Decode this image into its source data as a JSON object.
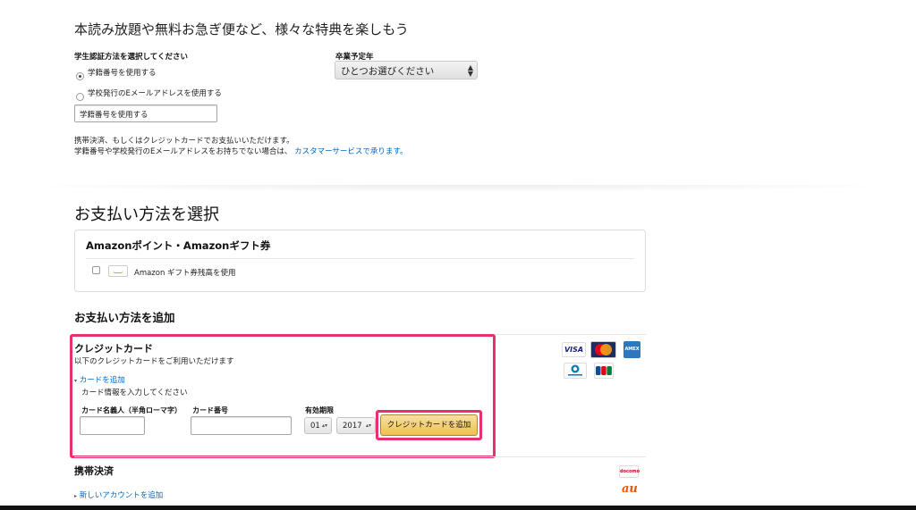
{
  "promo": {
    "heading": "本読み放題や無料お急ぎ便など、様々な特典を楽しもう",
    "verify_label": "学生認証方法を選択してください",
    "option_student_id": "学籍番号を使用する",
    "option_email": "学校発行のEメールアドレスを使用する",
    "input_value": "学籍番号を使用する",
    "grad_label": "卒業予定年",
    "grad_select": "ひとつお選びください",
    "note_line1": "携帯決済、もしくはクレジットカードでお支払いいただけます。",
    "note_line2_prefix": "学籍番号や学校発行のEメールアドレスをお持ちでない場合は、",
    "note_link": "カスタマーサービスで承ります。"
  },
  "payment": {
    "heading": "お支払い方法を選択",
    "gift_box_title": "Amazonポイント・Amazonギフト券",
    "gift_option_label": "Amazon ギフト券残高を使用",
    "add_heading": "お支払い方法を追加"
  },
  "credit_card": {
    "title": "クレジットカード",
    "subtitle": "以下のクレジットカードをご利用いただけます",
    "add_link": "カードを追加",
    "instruction": "カード情報を入力してください",
    "name_label": "カード名義人（半角ローマ字）",
    "number_label": "カード番号",
    "expiry_label": "有効期限",
    "month": "01",
    "year": "2017",
    "submit": "クレジットカードを追加",
    "logos": [
      "VISA",
      "MasterCard",
      "AMEX",
      "Diners Club International",
      "JCB"
    ]
  },
  "mobile": {
    "title": "携帯決済",
    "add_link": "新しいアカウントを追加",
    "logos": [
      "docomo",
      "au"
    ]
  },
  "colors": {
    "highlight": "#e8306e",
    "link": "#0066c0",
    "button": "#f0c14b"
  }
}
